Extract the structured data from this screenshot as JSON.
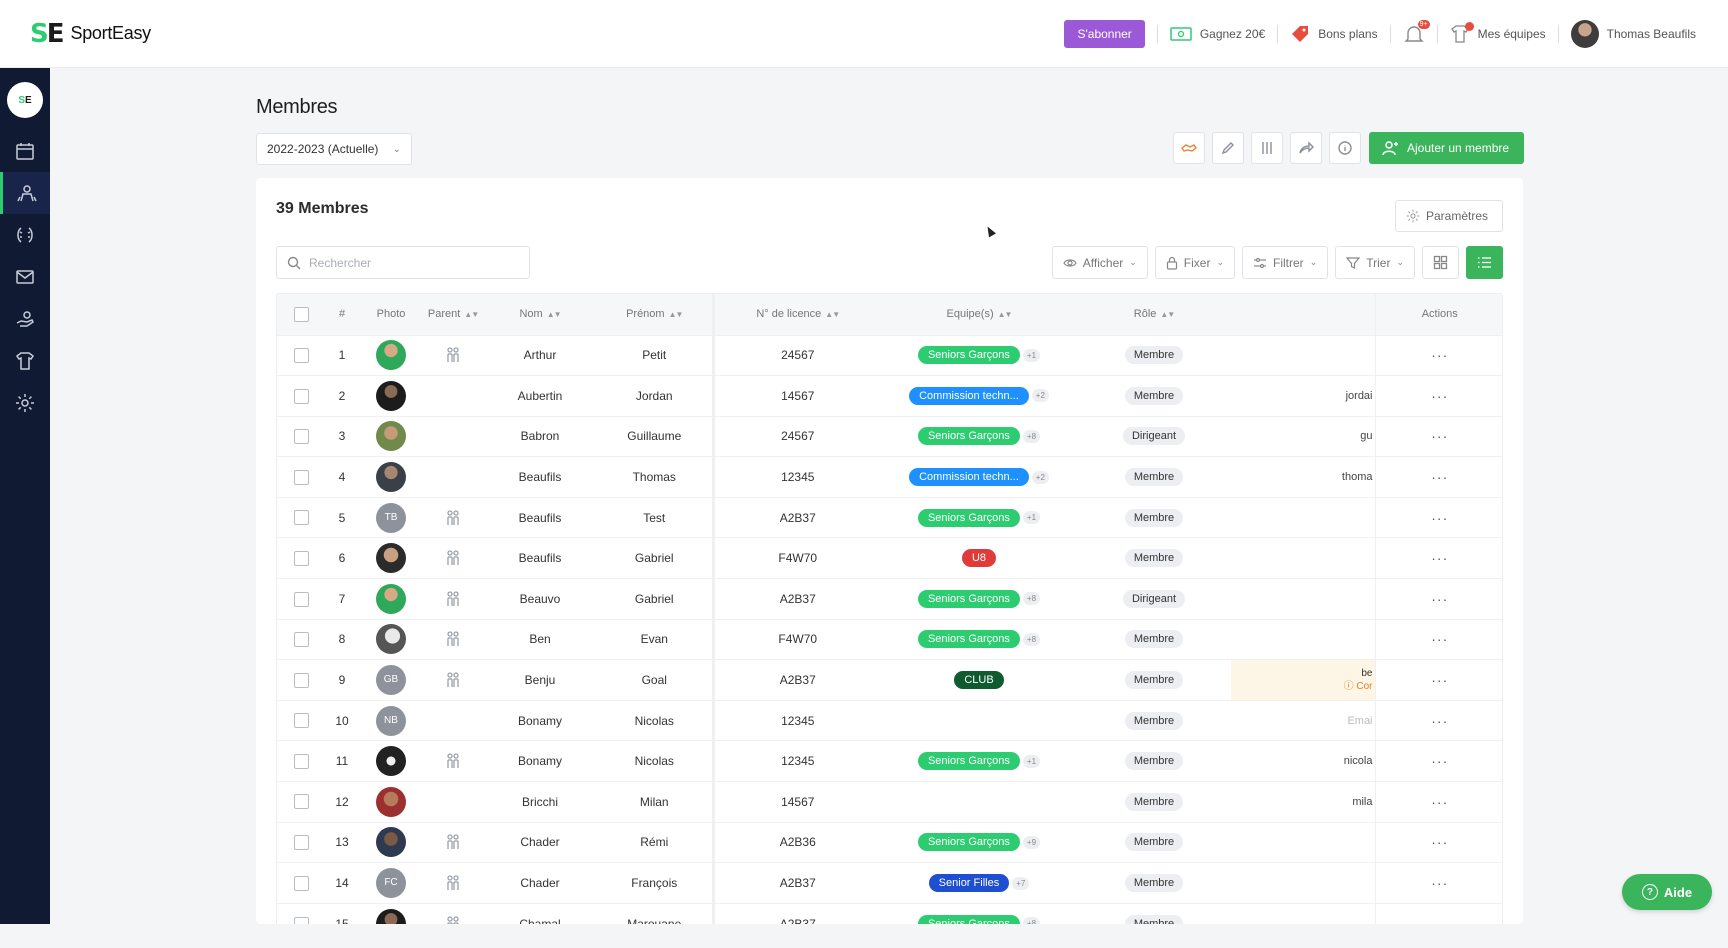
{
  "brand": {
    "name": "SportEasy"
  },
  "topbar": {
    "subscribe_label": "S'abonner",
    "earn_label": "Gagnez 20€",
    "deals_label": "Bons plans",
    "notif_badge": "9+",
    "teams_label": "Mes équipes",
    "user_name": "Thomas Beaufils"
  },
  "sidebar": {
    "items": [
      "calendar-icon",
      "members-icon",
      "stats-icon",
      "messages-icon",
      "payments-icon",
      "jersey-icon",
      "settings-icon"
    ],
    "active": "members-icon"
  },
  "page": {
    "title": "Membres",
    "season": "2022-2023 (Actuelle)",
    "add_member_label": "Ajouter un membre"
  },
  "card": {
    "count_label": "39 Membres",
    "params_label": "Paramètres",
    "search_placeholder": "Rechercher",
    "filters": {
      "show": "Afficher",
      "pin": "Fixer",
      "filter": "Filtrer",
      "sort": "Trier"
    }
  },
  "table": {
    "headers": {
      "num": "#",
      "photo": "Photo",
      "parent": "Parent",
      "lastname": "Nom",
      "firstname": "Prénom",
      "license": "N° de licence",
      "teams": "Equipe(s)",
      "role": "Rôle",
      "actions": "Actions"
    },
    "rows": [
      {
        "n": "1",
        "photo": "ph-a",
        "initials": "",
        "parent": true,
        "nom": "Arthur",
        "prenom": "Petit",
        "licence": "24567",
        "team": "Seniors Garçons",
        "team_color": "#2ecc71",
        "more": "+1",
        "role": "Membre",
        "extra": ""
      },
      {
        "n": "2",
        "photo": "ph-b",
        "initials": "",
        "parent": false,
        "nom": "Aubertin",
        "prenom": "Jordan",
        "licence": "14567",
        "team": "Commission techn...",
        "team_color": "#1e90ff",
        "more": "+2",
        "role": "Membre",
        "extra": "jordai"
      },
      {
        "n": "3",
        "photo": "ph-c",
        "initials": "",
        "parent": false,
        "nom": "Babron",
        "prenom": "Guillaume",
        "licence": "24567",
        "team": "Seniors Garçons",
        "team_color": "#2ecc71",
        "more": "+8",
        "role": "Dirigeant",
        "extra": "gu"
      },
      {
        "n": "4",
        "photo": "ph-d",
        "initials": "",
        "parent": false,
        "nom": "Beaufils",
        "prenom": "Thomas",
        "licence": "12345",
        "team": "Commission techn...",
        "team_color": "#1e90ff",
        "more": "+2",
        "role": "Membre",
        "extra": "thoma"
      },
      {
        "n": "5",
        "photo": "",
        "initials": "TB",
        "parent": true,
        "nom": "Beaufils",
        "prenom": "Test",
        "licence": "A2B37",
        "team": "Seniors Garçons",
        "team_color": "#2ecc71",
        "more": "+1",
        "role": "Membre",
        "extra": ""
      },
      {
        "n": "6",
        "photo": "ph-e",
        "initials": "",
        "parent": true,
        "nom": "Beaufils",
        "prenom": "Gabriel",
        "licence": "F4W70",
        "team": "U8",
        "team_color": "#e03b3b",
        "more": "",
        "role": "Membre",
        "extra": ""
      },
      {
        "n": "7",
        "photo": "ph-a",
        "initials": "",
        "parent": true,
        "nom": "Beauvo",
        "prenom": "Gabriel",
        "licence": "A2B37",
        "team": "Seniors Garçons",
        "team_color": "#2ecc71",
        "more": "+8",
        "role": "Dirigeant",
        "extra": ""
      },
      {
        "n": "8",
        "photo": "ph-f",
        "initials": "",
        "parent": true,
        "nom": "Ben",
        "prenom": "Evan",
        "licence": "F4W70",
        "team": "Seniors Garçons",
        "team_color": "#2ecc71",
        "more": "+8",
        "role": "Membre",
        "extra": ""
      },
      {
        "n": "9",
        "photo": "",
        "initials": "GB",
        "parent": true,
        "nom": "Benju",
        "prenom": "Goal",
        "licence": "A2B37",
        "team": "CLUB",
        "team_color": "#0f5a2e",
        "more": "",
        "role": "Membre",
        "extra": "warn"
      },
      {
        "n": "10",
        "photo": "",
        "initials": "NB",
        "parent": false,
        "nom": "Bonamy",
        "prenom": "Nicolas",
        "licence": "12345",
        "team": "",
        "team_color": "",
        "more": "",
        "role": "Membre",
        "extra": "Emai"
      },
      {
        "n": "11",
        "photo": "ph-g",
        "initials": "",
        "parent": true,
        "nom": "Bonamy",
        "prenom": "Nicolas",
        "licence": "12345",
        "team": "Seniors Garçons",
        "team_color": "#2ecc71",
        "more": "+1",
        "role": "Membre",
        "extra": "nicola"
      },
      {
        "n": "12",
        "photo": "ph-h",
        "initials": "",
        "parent": false,
        "nom": "Bricchi",
        "prenom": "Milan",
        "licence": "14567",
        "team": "",
        "team_color": "",
        "more": "",
        "role": "Membre",
        "extra": "mila"
      },
      {
        "n": "13",
        "photo": "ph-i",
        "initials": "",
        "parent": true,
        "nom": "Chader",
        "prenom": "Rémi",
        "licence": "A2B36",
        "team": "Seniors Garçons",
        "team_color": "#2ecc71",
        "more": "+9",
        "role": "Membre",
        "extra": ""
      },
      {
        "n": "14",
        "photo": "",
        "initials": "FC",
        "parent": true,
        "nom": "Chader",
        "prenom": "François",
        "licence": "A2B37",
        "team": "Senior Filles",
        "team_color": "#1f4fd1",
        "more": "+7",
        "role": "Membre",
        "extra": ""
      },
      {
        "n": "15",
        "photo": "ph-b",
        "initials": "",
        "parent": true,
        "nom": "Chamal",
        "prenom": "Marouane",
        "licence": "A2B37",
        "team": "Seniors Garçons",
        "team_color": "#2ecc71",
        "more": "+8",
        "role": "Membre",
        "extra": ""
      }
    ],
    "warn_line1": "be",
    "warn_line2": "Cor"
  },
  "help": {
    "label": "Aide"
  }
}
